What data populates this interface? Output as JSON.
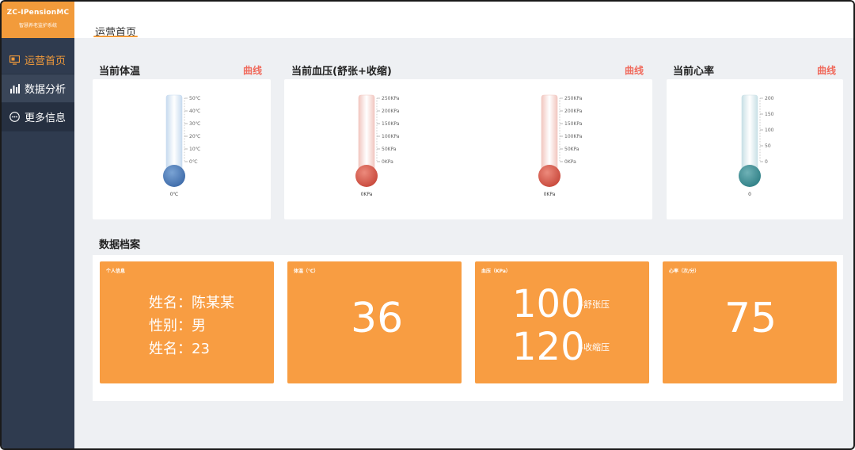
{
  "app": {
    "brand_name": "ZC-IPensionMC",
    "brand_sub": "智慧养老监护系统"
  },
  "sidebar": {
    "items": [
      {
        "label": "运营首页",
        "icon": "monitor-icon"
      },
      {
        "label": "数据分析",
        "icon": "bar-chart-icon"
      },
      {
        "label": "更多信息",
        "icon": "more-circle-icon"
      }
    ]
  },
  "header": {
    "tab": "运营首页"
  },
  "temperature": {
    "title": "当前体温",
    "link": "曲线",
    "ticks": [
      "50℃",
      "40℃",
      "30℃",
      "20℃",
      "10℃",
      "0℃"
    ],
    "value_label": "0℃",
    "value": 0
  },
  "blood_pressure": {
    "title": "当前血压(舒张+收缩)",
    "link": "曲线",
    "ticks": [
      "250KPa",
      "200KPa",
      "150KPa",
      "100KPa",
      "50KPa",
      "0KPa"
    ],
    "gauges": [
      {
        "value_label": "0KPa",
        "value": 0
      },
      {
        "value_label": "0KPa",
        "value": 0
      }
    ]
  },
  "heart_rate": {
    "title": "当前心率",
    "link": "曲线",
    "ticks": [
      "200",
      "150",
      "100",
      "50",
      "0"
    ],
    "value_label": "0",
    "value": 0
  },
  "archive": {
    "title": "数据档案",
    "personal": {
      "title": "个人信息",
      "rows": [
        "姓名：陈某某",
        "性别：男",
        "姓名：23"
      ]
    },
    "temp": {
      "title": "体温（℃）",
      "value": "36"
    },
    "bp": {
      "title": "血压（KPa）",
      "diastolic": "100",
      "diastolic_label": "-舒张压",
      "systolic": "120",
      "systolic_label": "-收缩压"
    },
    "hr": {
      "title": "心率（次/分）",
      "value": "75"
    }
  },
  "colors": {
    "accent": "#f29b3b",
    "sidebar": "#2f3b4f",
    "tile": "#f89d42",
    "link": "#f06a5c",
    "temp_bulb": "#3d6aa8",
    "bp_bulb": "#c7473a",
    "hr_bulb": "#2f7f85"
  }
}
